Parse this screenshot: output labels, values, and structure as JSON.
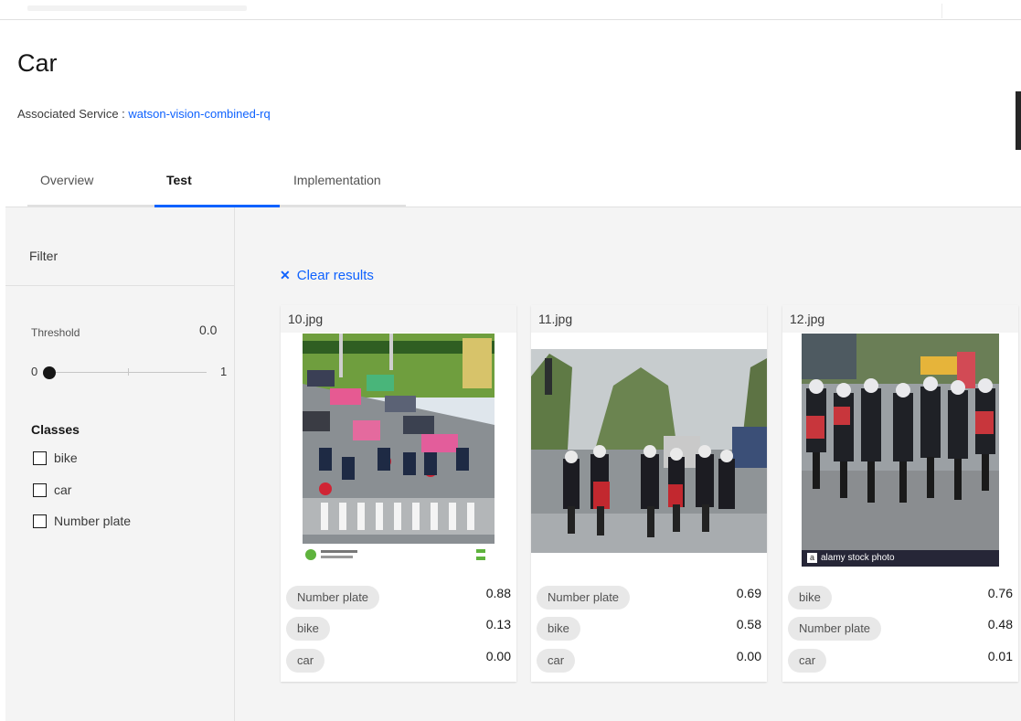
{
  "page": {
    "title": "Car",
    "associated_service_label": "Associated Service : ",
    "associated_service_link": "watson-vision-combined-rq"
  },
  "tabs": [
    {
      "label": "Overview",
      "active": false
    },
    {
      "label": "Test",
      "active": true
    },
    {
      "label": "Implementation",
      "active": false
    }
  ],
  "filter": {
    "title": "Filter",
    "threshold_label": "Threshold",
    "threshold_value": "0.0",
    "slider_min": "0",
    "slider_max": "1",
    "slider_level": 0.0,
    "classes_title": "Classes",
    "classes": [
      {
        "label": "bike",
        "checked": false
      },
      {
        "label": "car",
        "checked": false
      },
      {
        "label": "Number plate",
        "checked": false
      }
    ]
  },
  "results": {
    "clear_label": "Clear results",
    "cards": [
      {
        "filename": "10.jpg",
        "rows": [
          {
            "class": "Number plate",
            "score": "0.88"
          },
          {
            "class": "bike",
            "score": "0.13"
          },
          {
            "class": "car",
            "score": "0.00"
          }
        ]
      },
      {
        "filename": "11.jpg",
        "rows": [
          {
            "class": "Number plate",
            "score": "0.69"
          },
          {
            "class": "bike",
            "score": "0.58"
          },
          {
            "class": "car",
            "score": "0.00"
          }
        ]
      },
      {
        "filename": "12.jpg",
        "watermark": "alamy stock photo",
        "rows": [
          {
            "class": "bike",
            "score": "0.76"
          },
          {
            "class": "Number plate",
            "score": "0.48"
          },
          {
            "class": "car",
            "score": "0.01"
          }
        ]
      }
    ]
  },
  "colors": {
    "accent": "#0f62fe",
    "tag_background": "#e8e8e8",
    "panel_background": "#f4f4f4"
  }
}
